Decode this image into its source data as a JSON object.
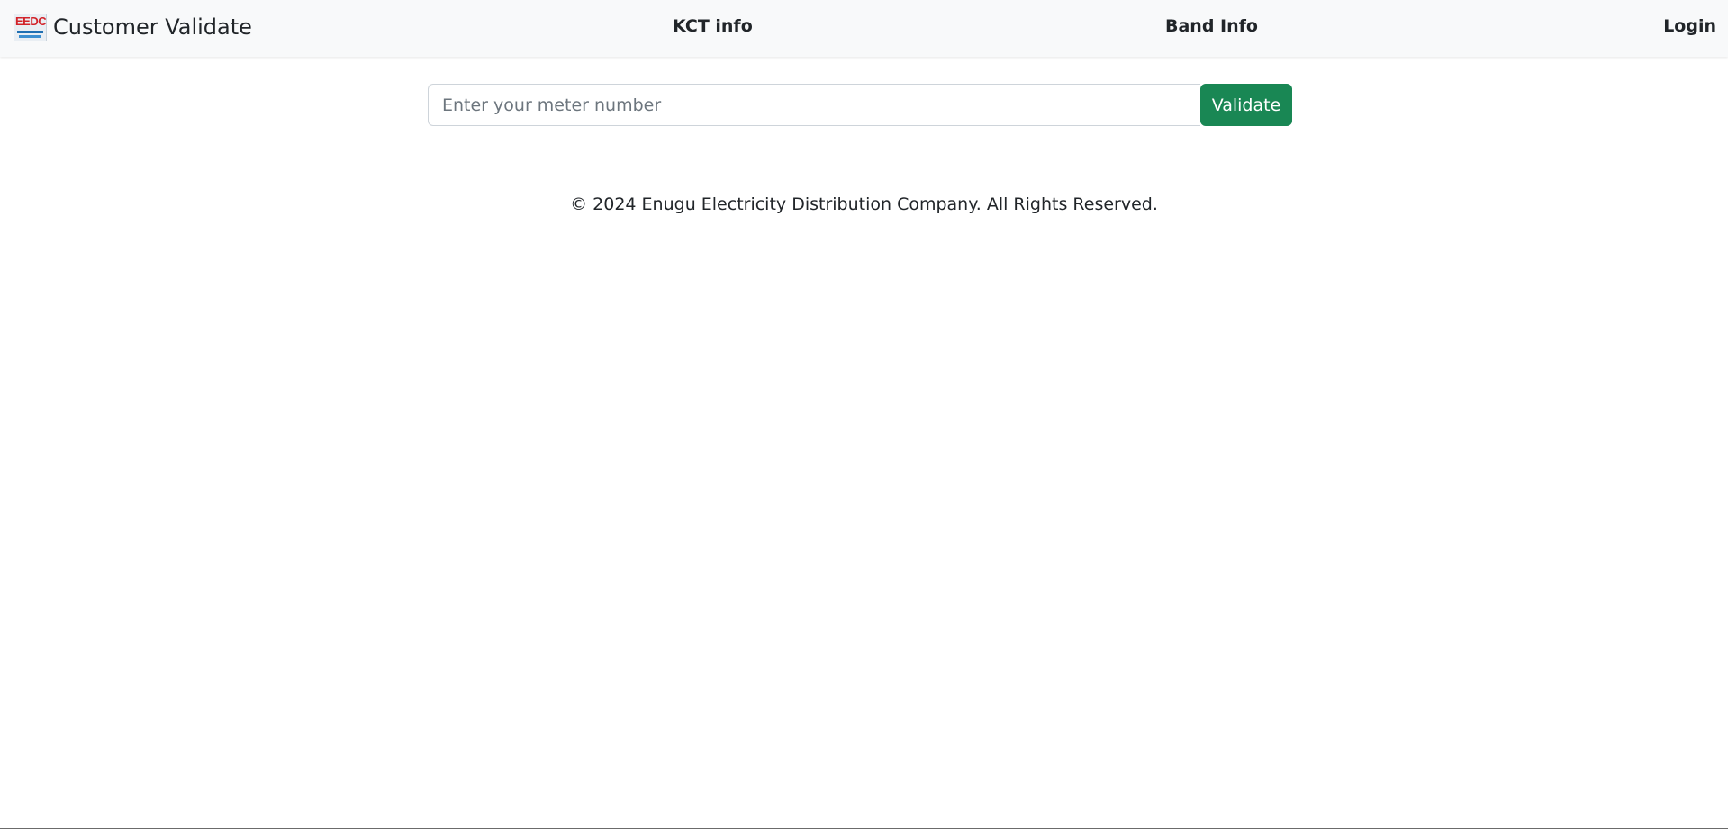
{
  "navbar": {
    "brand": {
      "logo_text": "EEDC",
      "title": "Customer Validate"
    },
    "links": {
      "kct": "KCT info",
      "band": "Band Info",
      "login": "Login"
    }
  },
  "form": {
    "meter_input": {
      "placeholder": "Enter your meter number",
      "value": ""
    },
    "validate_label": "Validate"
  },
  "footer": {
    "copyright": "© 2024 Enugu Electricity Distribution Company. All Rights Reserved."
  },
  "colors": {
    "navbar_bg": "#f8f9fa",
    "primary_button": "#198754",
    "logo_red": "#d2232a",
    "logo_blue": "#1f6fb2"
  }
}
